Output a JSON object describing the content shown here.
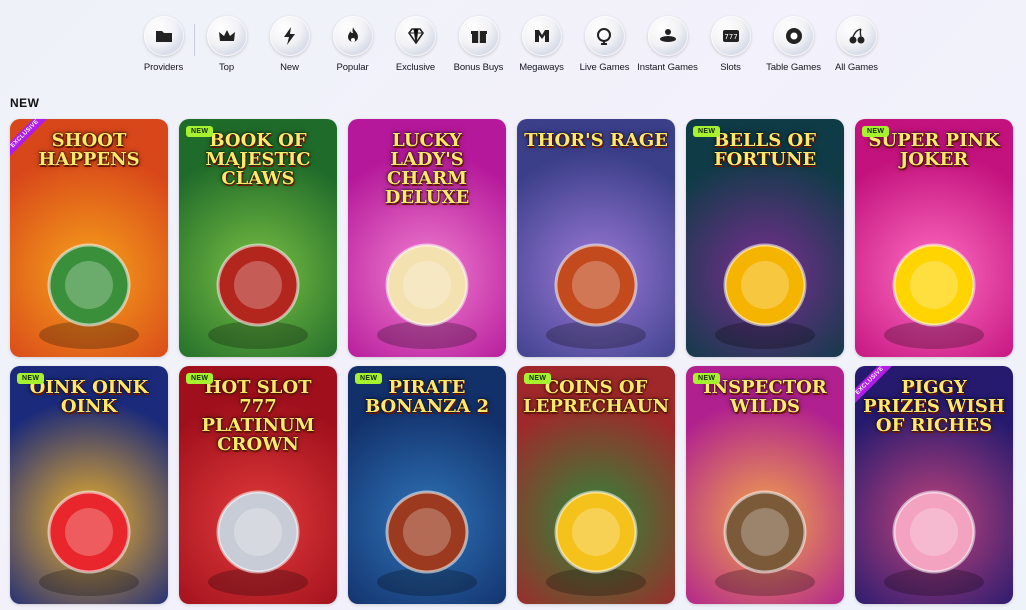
{
  "categories": [
    {
      "label": "Providers",
      "icon": "folder-icon"
    },
    {
      "label": "Top",
      "icon": "crown-icon"
    },
    {
      "label": "New",
      "icon": "lightning-icon"
    },
    {
      "label": "Popular",
      "icon": "flame-icon"
    },
    {
      "label": "Exclusive",
      "icon": "diamond-icon"
    },
    {
      "label": "Bonus Buys",
      "icon": "gift-icon"
    },
    {
      "label": "Megaways",
      "icon": "megaways-icon"
    },
    {
      "label": "Live Games",
      "icon": "live-icon"
    },
    {
      "label": "Instant Games",
      "icon": "instant-icon"
    },
    {
      "label": "Slots",
      "icon": "slot-icon"
    },
    {
      "label": "Table Games",
      "icon": "chip-icon"
    },
    {
      "label": "All Games",
      "icon": "cherries-icon"
    }
  ],
  "section": {
    "title": "NEW"
  },
  "badges": {
    "new": "NEW",
    "exclusive": "EXCLUSIVE"
  },
  "games": [
    {
      "title": "SHOOT HAPPENS",
      "badge": "exclusive",
      "bg": "#d8471a",
      "bg2": "#f6a21b",
      "accent": "#3a8f3a"
    },
    {
      "title": "BOOK OF MAJESTIC CLAWS",
      "badge": "new",
      "bg": "#1f6b2a",
      "bg2": "#7ac043",
      "accent": "#b3261e"
    },
    {
      "title": "Lucky Lady's Charm deluxe",
      "badge": "",
      "bg": "#b5189a",
      "bg2": "#f07fd0",
      "accent": "#f4e1b0"
    },
    {
      "title": "THOR'S RAGE",
      "badge": "",
      "bg": "#3b3f8a",
      "bg2": "#9d7ad8",
      "accent": "#c24a1c"
    },
    {
      "title": "BELLS OF FORTUNE",
      "badge": "new",
      "bg": "#0e3b46",
      "bg2": "#7a2d91",
      "accent": "#f5b400"
    },
    {
      "title": "SUPER PINK JOKER",
      "badge": "new",
      "bg": "#c3127d",
      "bg2": "#ff6ec2",
      "accent": "#ffd400"
    },
    {
      "title": "OINK OINK OINK",
      "badge": "new",
      "bg": "#1b2a7a",
      "bg2": "#f0b229",
      "accent": "#e8262b"
    },
    {
      "title": "HOT SLOT 777 PLATINUM CROWN",
      "badge": "new",
      "bg": "#a0101c",
      "bg2": "#e23b3b",
      "accent": "#c8ccd6"
    },
    {
      "title": "PIRATE BONANZA 2",
      "badge": "new",
      "bg": "#12306a",
      "bg2": "#2f74b8",
      "accent": "#9b3a1e"
    },
    {
      "title": "COINS OF LEPRECHAUN",
      "badge": "new",
      "bg": "#a0282a",
      "bg2": "#2c8a3a",
      "accent": "#f4c21b"
    },
    {
      "title": "INSPECTOR WILDS",
      "badge": "new",
      "bg": "#b0208f",
      "bg2": "#f2a64a",
      "accent": "#7b5a3a"
    },
    {
      "title": "PIGGY PRIZES Wish of RICHES",
      "badge": "exclusive",
      "bg": "#251a6e",
      "bg2": "#c1437b",
      "accent": "#f3a3c0"
    }
  ],
  "colors": {
    "new_badge": "#a6f22e",
    "exclusive_badge": "#b11de6"
  }
}
